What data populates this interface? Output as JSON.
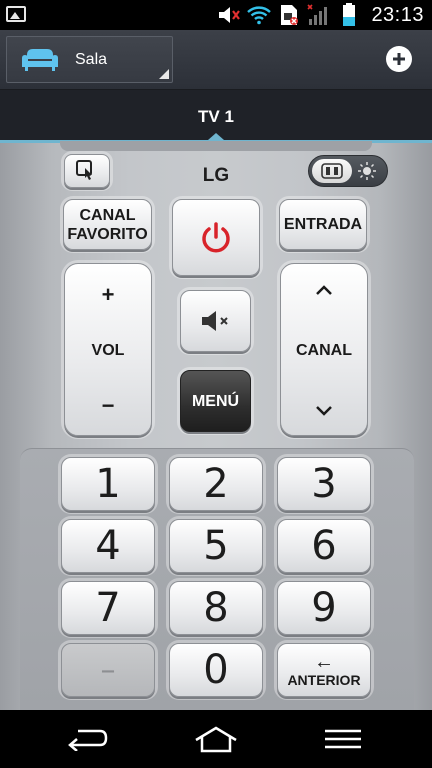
{
  "status_bar": {
    "time": "23:13",
    "icons": [
      "image-icon",
      "volume-muted-icon",
      "wifi-icon",
      "sim-blocked-icon",
      "signal-no-sim-icon",
      "battery-icon"
    ]
  },
  "room_bar": {
    "room_name": "Sala",
    "room_icon": "sofa-icon",
    "add_icon": "plus-circle-icon"
  },
  "tabs": [
    {
      "label": "TV 1",
      "active": true
    }
  ],
  "remote": {
    "brand": "LG",
    "canal_favorito": "CANAL FAVORITO",
    "entrada": "ENTRADA",
    "vol_plus": "+",
    "vol_label": "VOL",
    "vol_minus": "−",
    "canal_label": "CANAL",
    "menu": "MENÚ",
    "keys": [
      "1",
      "2",
      "3",
      "4",
      "5",
      "6",
      "7",
      "8",
      "9",
      "–",
      "0"
    ],
    "anterior": "ANTERIOR",
    "anterior_arrow": "←"
  },
  "colors": {
    "accent": "#6fb5cf",
    "power_red": "#d8232a",
    "sofa_blue": "#5fc3ee"
  },
  "nav_bar": [
    "back-icon",
    "home-icon",
    "menu-icon"
  ]
}
